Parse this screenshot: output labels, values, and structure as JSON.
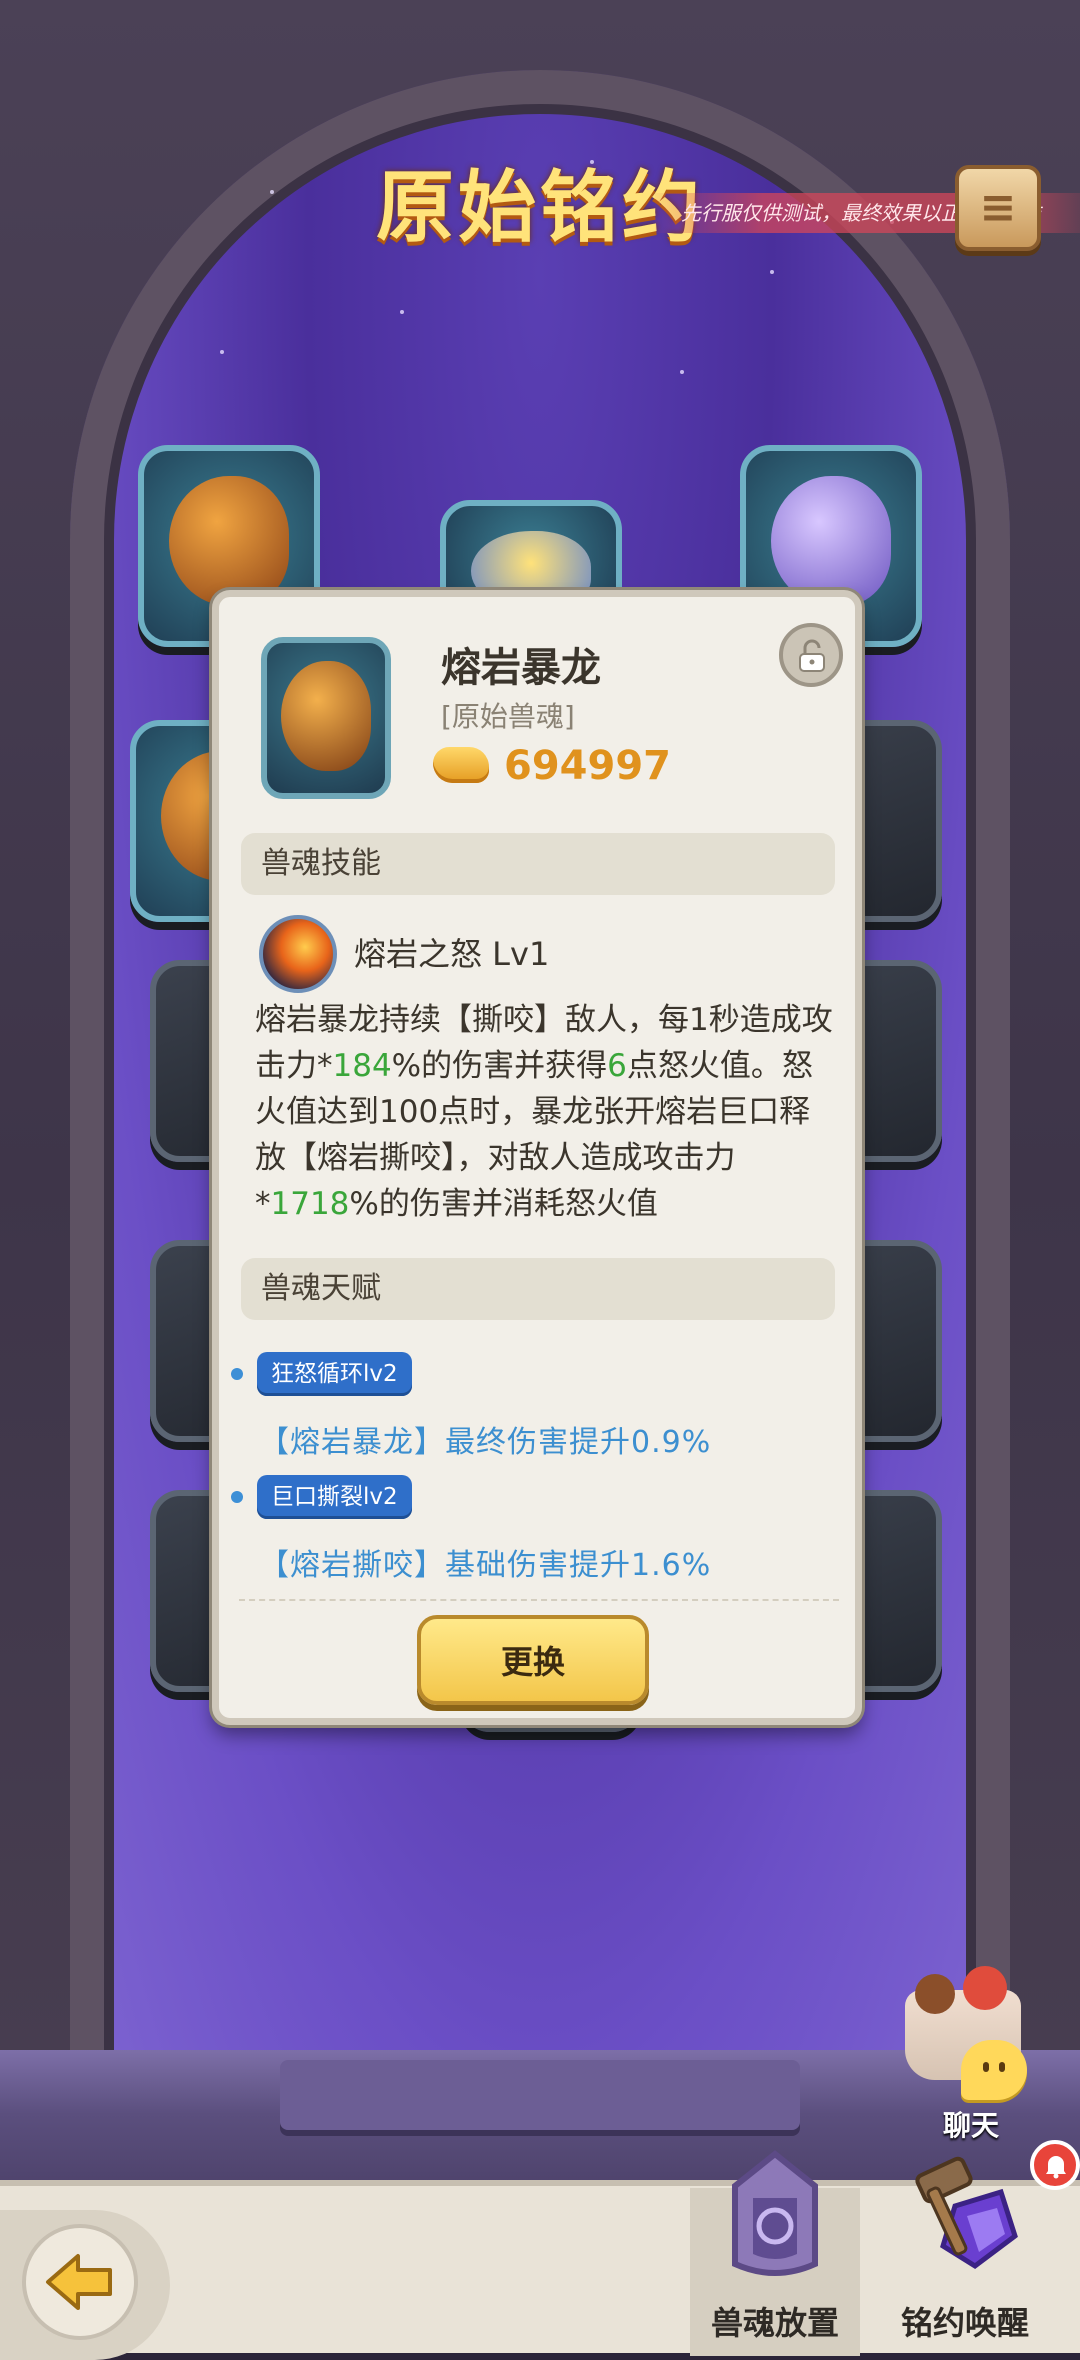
{
  "header": {
    "title": "原始铭约",
    "test_banner": "先行服仅供测试，最终效果以正式服为准",
    "scroll_icon": "scroll-icon"
  },
  "card": {
    "monster_name": "熔岩暴龙",
    "monster_type": "[原始兽魂]",
    "gold_value": "694997",
    "lock_icon": "unlock-icon",
    "skill_section_title": "兽魂技能",
    "skill": {
      "name": "熔岩之怒 Lv1",
      "desc_segments": [
        "熔岩暴龙持续【撕咬】敌人，每1秒造成攻击力*",
        "184",
        "%的伤害并获得",
        "6",
        "点怒火值。怒火值达到100点时，暴龙张开熔岩巨口释放【熔岩撕咬】，对敌人造成攻击力*",
        "1718",
        "%的伤害并消耗怒火值"
      ]
    },
    "talent_section_title": "兽魂天赋",
    "talents": [
      {
        "tag": "狂怒循环lv2",
        "desc": "【熔岩暴龙】最终伤害提升0.9%"
      },
      {
        "tag": "巨口撕裂lv2",
        "desc": "【熔岩撕咬】基础伤害提升1.6%"
      }
    ],
    "swap_button": "更换"
  },
  "chat": {
    "label": "聊天"
  },
  "bottom_nav": {
    "back_icon": "arrow-left-icon",
    "tabs": [
      {
        "label": "兽魂放置",
        "icon": "shrine-icon"
      },
      {
        "label": "铭约唤醒",
        "icon": "hammer-crystal-icon"
      }
    ]
  },
  "colors": {
    "title": "#ffe37a",
    "highlight_green": "#3aa63a",
    "talent_blue": "#3c8fd0",
    "tag_blue": "#2f6fc9",
    "gold": "#e0921d",
    "button_yellow": "#f3c64a"
  }
}
